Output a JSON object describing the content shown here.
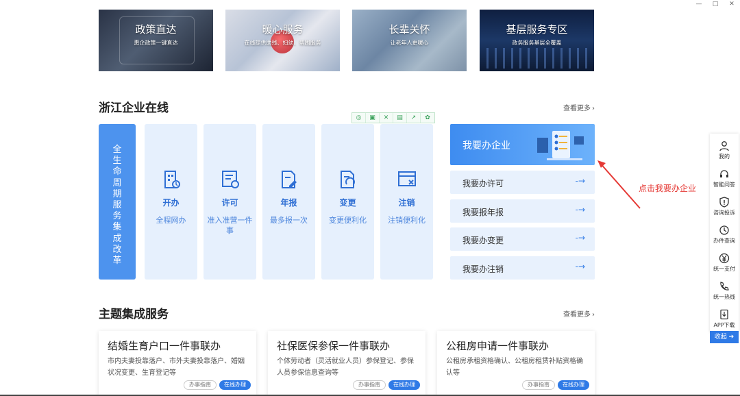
{
  "window": {
    "minimize": "—",
    "maximize": "□",
    "close": "✕"
  },
  "banners": [
    {
      "title": "政策直达",
      "subtitle": "惠企政策一键直达"
    },
    {
      "title": "暖心服务",
      "subtitle": "在线提供助残、妇幼、帮困服务"
    },
    {
      "title": "长辈关怀",
      "subtitle": "让老年人更暖心"
    },
    {
      "title": "基层服务专区",
      "subtitle": "政务服务基层全覆盖"
    }
  ],
  "enterprise": {
    "title": "浙江企业在线",
    "more": "查看更多",
    "lifecycle": "全生命周期服务集成改革",
    "services": [
      {
        "name": "开办",
        "desc": "全程网办",
        "icon": "building-icon"
      },
      {
        "name": "许可",
        "desc": "准入准营一件事",
        "icon": "certificate-icon"
      },
      {
        "name": "年报",
        "desc": "最多报一次",
        "icon": "edit-document-icon"
      },
      {
        "name": "变更",
        "desc": "变更便利化",
        "icon": "document-change-icon"
      },
      {
        "name": "注销",
        "desc": "注销便利化",
        "icon": "window-close-icon"
      }
    ],
    "main_action": "我要办企业",
    "actions": [
      "我要办许可",
      "我要报年报",
      "我要办变更",
      "我要办注销"
    ],
    "arrow": "-→"
  },
  "annotation": "点击我要办企业",
  "theme": {
    "title": "主题集成服务",
    "more": "查看更多",
    "cards": [
      {
        "title": "结婚生育户口一件事联办",
        "desc": "市内夫妻投靠落户、市外夫妻投靠落户、婚姻状况变更、生育登记等",
        "guide": "办事指南",
        "online": "在线办理"
      },
      {
        "title": "社保医保参保一件事联办",
        "desc": "个体劳动者（灵活就业人员）参保登记、参保人员参保信息查询等",
        "guide": "办事指南",
        "online": "在线办理"
      },
      {
        "title": "公租房申请一件事联办",
        "desc": "公租房承租资格确认、公租房租赁补贴资格确认等",
        "guide": "办事指南",
        "online": "在线办理"
      }
    ]
  },
  "sidebar": {
    "items": [
      {
        "label": "我的",
        "icon": "user-icon"
      },
      {
        "label": "智能问答",
        "icon": "headset-icon"
      },
      {
        "label": "咨询投诉",
        "icon": "alert-shield-icon"
      },
      {
        "label": "办件查询",
        "icon": "history-icon"
      },
      {
        "label": "统一支付",
        "icon": "yuan-icon"
      },
      {
        "label": "统一热线",
        "icon": "phone-icon"
      },
      {
        "label": "APP下载",
        "icon": "download-icon"
      }
    ],
    "collapse": "收起"
  },
  "colors": {
    "primary": "#2f7ae6",
    "light": "#e6f0fd",
    "annotation": "#e53935"
  }
}
